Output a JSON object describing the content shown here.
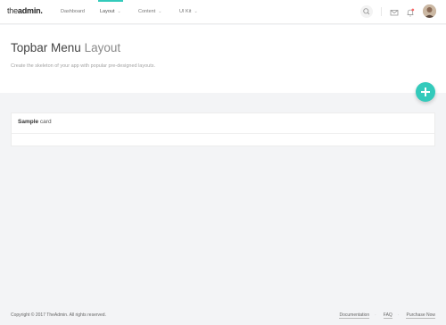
{
  "brand": {
    "prefix": "the",
    "name": "admin."
  },
  "nav": {
    "items": [
      {
        "label": "Dashboard"
      },
      {
        "label": "Layout"
      },
      {
        "label": "Content"
      },
      {
        "label": "UI Kit"
      }
    ]
  },
  "header": {
    "title_main": "Topbar Menu",
    "title_light": "Layout",
    "subtitle": "Create the skeleton of your app with popular pre-designed layouts."
  },
  "card": {
    "title_bold": "Sample",
    "title_rest": " card"
  },
  "footer": {
    "copyright": "Copyright © 2017 TheAdmin. All rights reserved.",
    "links": [
      "Documentation",
      "FAQ",
      "Purchase Now"
    ]
  },
  "colors": {
    "accent": "#33cabb",
    "notification": "#f96868"
  },
  "icons": [
    "search-icon",
    "mail-icon",
    "bell-icon",
    "plus-icon",
    "chevron-down-icon"
  ]
}
